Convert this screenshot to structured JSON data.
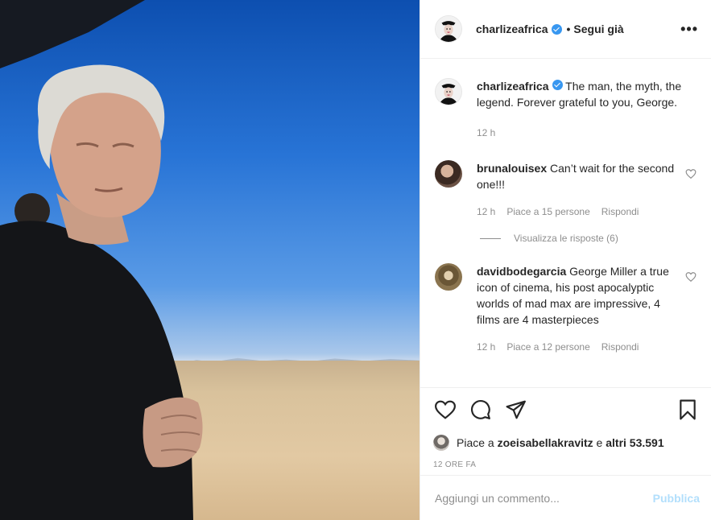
{
  "post": {
    "author": "charlizeafrica",
    "separator": "•",
    "follow_label": "Segui già",
    "more_label": "•••"
  },
  "caption": {
    "author": "charlizeafrica",
    "text": "The man, the myth, the legend. Forever grateful to you, George.",
    "time": "12 h"
  },
  "comments": [
    {
      "author": "brunalouisex",
      "text": "Can’t wait for the second one!!!",
      "time": "12 h",
      "likes": "Piace a 15 persone",
      "reply_label": "Rispondi",
      "view_replies": "Visualizza le risposte (6)"
    },
    {
      "author": "davidbodegarcia",
      "text": "George Miller a true icon of cinema, his post apocalyptic worlds of mad max are impressive, 4 films are 4 masterpieces",
      "time": "12 h",
      "likes": "Piace a 12 persone",
      "reply_label": "Rispondi"
    }
  ],
  "likes": {
    "prefix": "Piace a",
    "user": "zoeisabellakravitz",
    "conj": "e",
    "others": "altri 53.591"
  },
  "timestamp": "12 ORE FA",
  "composer": {
    "placeholder": "Aggiungi un commento...",
    "publish_label": "Pubblica"
  },
  "icons": {
    "like": "heart-icon",
    "comment": "comment-icon",
    "share": "paper-plane-icon",
    "save": "bookmark-icon",
    "verified": "verified-badge-icon",
    "more": "more-options-icon"
  },
  "colors": {
    "text": "#262626",
    "secondary": "#8e8e8e",
    "verified": "#3897f0",
    "publish_disabled": "#b2dffc",
    "border": "#efefef"
  }
}
